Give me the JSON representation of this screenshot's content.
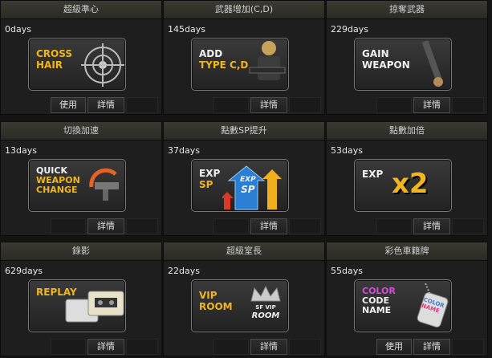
{
  "items": [
    {
      "title": "超級準心",
      "days": "0days",
      "card": [
        "CROSS",
        "HAIR"
      ],
      "use": "使用",
      "detail": "詳情"
    },
    {
      "title": "武器增加(C,D)",
      "days": "145days",
      "card": [
        "ADD",
        "TYPE C,D"
      ],
      "detail": "詳情"
    },
    {
      "title": "掠奪武器",
      "days": "229days",
      "card": [
        "GAIN",
        "WEAPON"
      ],
      "detail": "詳情"
    },
    {
      "title": "切換加速",
      "days": "13days",
      "card": [
        "QUICK",
        "WEAPON",
        "CHANGE"
      ],
      "detail": "詳情"
    },
    {
      "title": "點數SP提升",
      "days": "37days",
      "card": [
        "EXP",
        "SP"
      ],
      "badge": [
        "EXP",
        "SP"
      ],
      "detail": "詳情"
    },
    {
      "title": "點數加倍",
      "days": "53days",
      "card": [
        "EXP"
      ],
      "badge": [
        "x2"
      ],
      "detail": "詳情"
    },
    {
      "title": "錄影",
      "days": "629days",
      "card": [
        "REPLAY"
      ],
      "detail": "詳情"
    },
    {
      "title": "超級室長",
      "days": "22days",
      "card": [
        "VIP",
        "ROOM"
      ],
      "badge": [
        "SF VIP",
        "ROOM"
      ],
      "detail": "詳情"
    },
    {
      "title": "彩色車籍牌",
      "days": "55days",
      "card": [
        "COLOR",
        "CODE",
        "NAME"
      ],
      "badge": [
        "COLOR",
        "NAME"
      ],
      "use": "使用",
      "detail": "詳情"
    }
  ],
  "colors": {
    "accent_yellow": "#f2b51e",
    "background": "#141414",
    "header": "#34342d"
  },
  "icons": [
    "crosshair-icon",
    "soldier-icon",
    "rifle-icon",
    "weapon-swap-icon",
    "up-arrows-icon",
    "videotape-icon",
    "crown-icon",
    "dog-tag-icon"
  ]
}
